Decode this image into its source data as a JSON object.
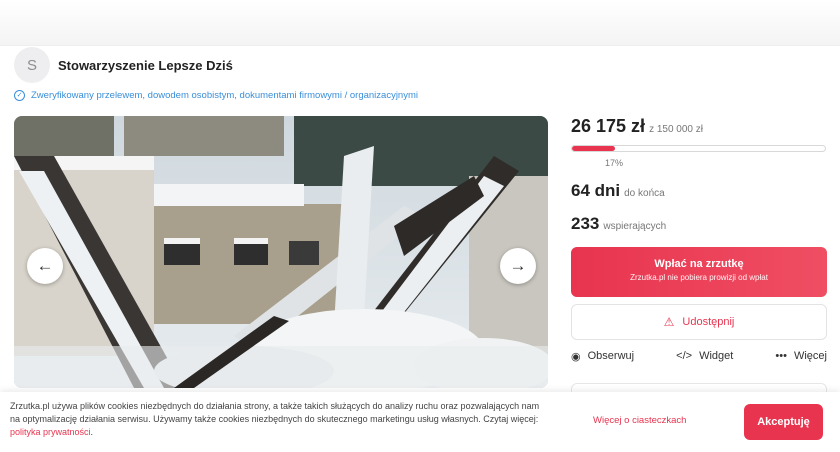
{
  "organizer": {
    "avatar_letter": "S",
    "name": "Stowarzyszenie Lepsze Dziś",
    "verified_text": "Zweryfikowany przelewem, dowodem osobistym, dokumentami firmowymi / organizacyjnymi"
  },
  "gallery": {
    "prev_arrow": "←",
    "next_arrow": "→",
    "image_subject": "snow-covered burned house ruins"
  },
  "campaign": {
    "raised": "26 175 zł",
    "goal": "z 150 000 zł",
    "percent_label": "17%",
    "progress_fraction": 0.17,
    "days_value": "64 dni",
    "days_label": "do końca",
    "supporters_value": "233",
    "supporters_label": "wspierających"
  },
  "donate": {
    "label": "Wpłać na zrzutkę",
    "sublabel": "Zrzutka.pl nie pobiera prowizji od wpłat"
  },
  "share": {
    "icon": "share-icon",
    "label": "Udostępnij"
  },
  "actions": {
    "observe": {
      "icon": "eye-icon",
      "label": "Obserwuj"
    },
    "widget": {
      "icon": "code-icon",
      "label": "Widget"
    },
    "more": {
      "icon": "ellipsis-icon",
      "label": "Więcej"
    }
  },
  "cookie": {
    "text": "Zrzutka.pl używa plików cookies niezbędnych do działania strony, a także takich służących do analizy ruchu oraz pozwalających nam na optymalizację działania serwisu. Używamy także cookies niezbędnych do skutecznego marketingu usług własnych. Czytaj więcej: ",
    "privacy_link": "polityka prywatności",
    "privacy_suffix": ".",
    "more_link": "Więcej o ciasteczkach",
    "accept_label": "Akceptuję"
  },
  "colors": {
    "accent": "#e8344f",
    "verified": "#3a8fd9"
  }
}
